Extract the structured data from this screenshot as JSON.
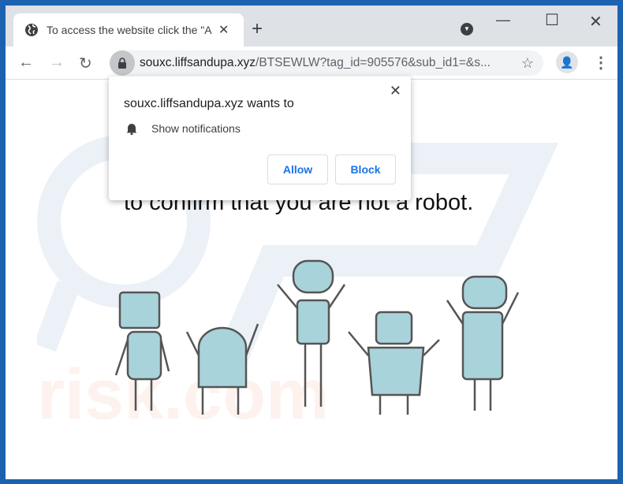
{
  "browser": {
    "tab_title": "To access the website click the \"Allow\"",
    "tab_icon": "globe-icon",
    "new_tab": "+",
    "url_host": "souxc.liffsandupa.xyz",
    "url_rest": "/BTSEWLW?tag_id=905576&sub_id1=&s..."
  },
  "page": {
    "message": "to confirm that you are not a robot."
  },
  "popup": {
    "title": "souxc.liffsandupa.xyz wants to",
    "permission": "Show notifications",
    "allow": "Allow",
    "block": "Block",
    "close": "✕"
  },
  "colors": {
    "frame": "#1c62b0",
    "accent": "#1a73e8",
    "robot": "#a9d3db"
  }
}
